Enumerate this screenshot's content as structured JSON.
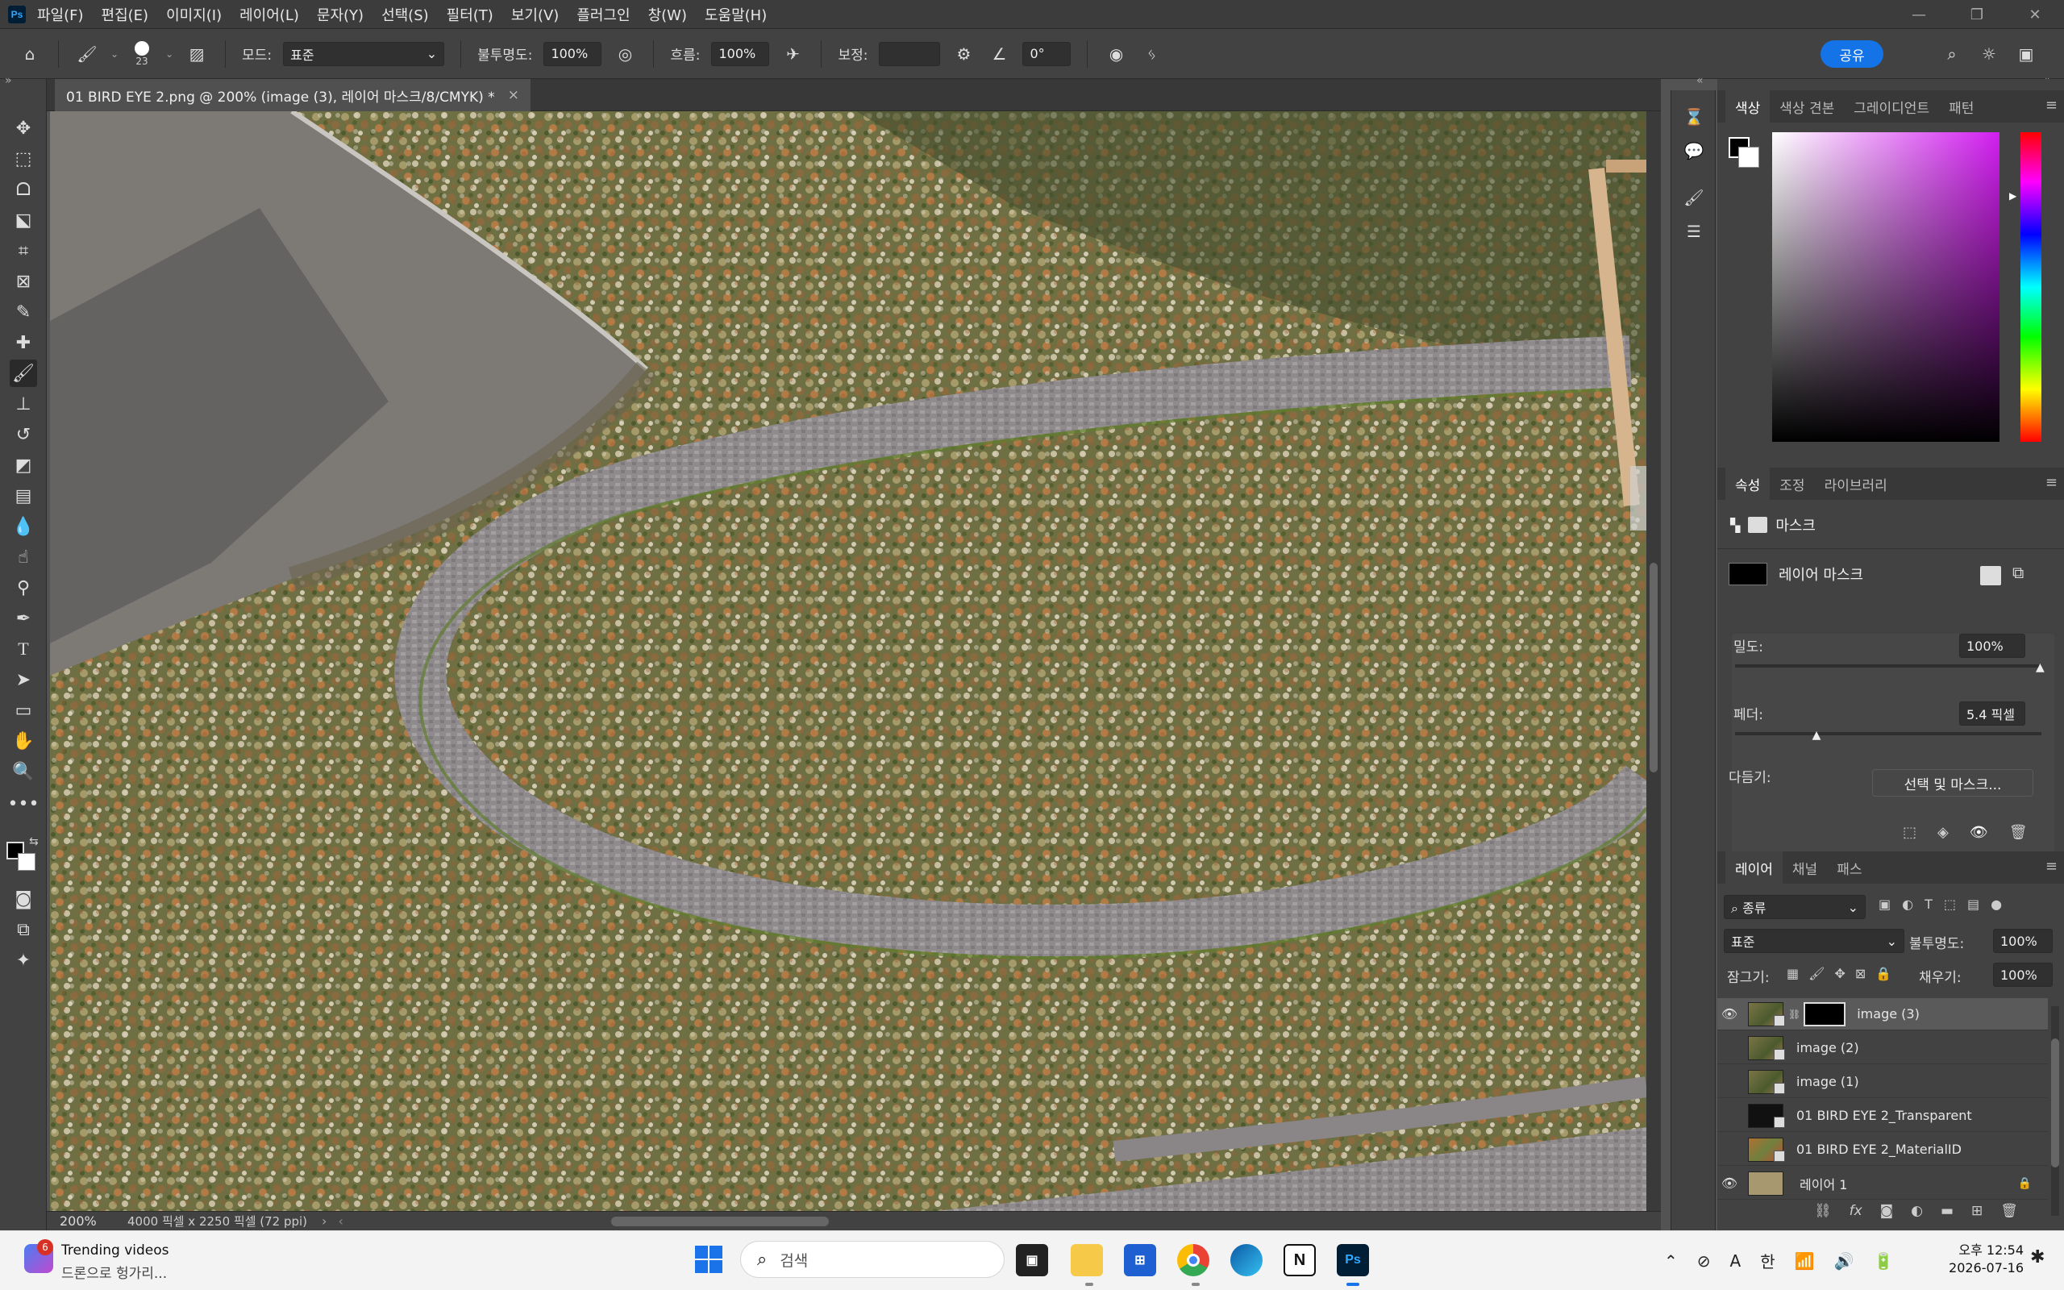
{
  "app": {
    "logo": "Ps"
  },
  "menu": [
    "파일(F)",
    "편집(E)",
    "이미지(I)",
    "레이어(L)",
    "문자(Y)",
    "선택(S)",
    "필터(T)",
    "보기(V)",
    "플러그인",
    "창(W)",
    "도움말(H)"
  ],
  "window_controls": [
    "minimize-icon",
    "restore-icon",
    "close-icon"
  ],
  "options": {
    "brush_size": "23",
    "mode_label": "모드:",
    "mode_value": "표준",
    "opacity_label": "불투명도:",
    "opacity_value": "100%",
    "flow_label": "흐름:",
    "flow_value": "100%",
    "smoothing_label": "보정:",
    "angle_value": "0°",
    "share_label": "공유"
  },
  "document": {
    "tab_title": "01 BIRD EYE 2.png @ 200% (image (3), 레이어 마스크/8/CMYK) *",
    "close_glyph": "×",
    "zoom": "200%",
    "info": "4000 픽셀 x 2250 픽셀 (72 ppi)"
  },
  "color_panel": {
    "tabs": [
      "색상",
      "색상 견본",
      "그레이디언트",
      "패턴"
    ],
    "active": 0,
    "hue_color": "#d21ef0"
  },
  "properties_panel": {
    "tabs": [
      "속성",
      "조정",
      "라이브러리"
    ],
    "active": 0,
    "section_title": "마스크",
    "mask_name": "레이어 마스크",
    "density_label": "밀도:",
    "density_value": "100%",
    "density_level": 1.0,
    "feather_label": "페더:",
    "feather_value": "5.4 픽셀",
    "feather_level": 0.27,
    "refine_label": "다듬기:",
    "refine_button": "선택 및 마스크..."
  },
  "layers_panel": {
    "tabs": [
      "레이어",
      "채널",
      "패스"
    ],
    "active": 0,
    "filter_label": "종류",
    "blend_mode": "표준",
    "opacity_label": "불투명도:",
    "opacity_value": "100%",
    "lock_label": "잠그기:",
    "fill_label": "채우기:",
    "fill_value": "100%",
    "layers": [
      {
        "name": "image (3)",
        "visible": true,
        "selected": true,
        "mask": true
      },
      {
        "name": "image (2)",
        "visible": false
      },
      {
        "name": "image (1)",
        "visible": false
      },
      {
        "name": "01 BIRD EYE 2_Transparent",
        "visible": false
      },
      {
        "name": "01 BIRD EYE 2_MaterialID",
        "visible": false
      },
      {
        "name": "레이어 1",
        "visible": true,
        "locked": true
      }
    ]
  },
  "taskbar": {
    "widget_badge": "6",
    "widget_title": "Trending videos",
    "widget_subtitle": "드론으로 헝가리...",
    "search_placeholder": "검색",
    "tray_ime_a": "A",
    "tray_ime_han": "한",
    "time": "오후 12:54",
    "date": "2026-07-16"
  }
}
